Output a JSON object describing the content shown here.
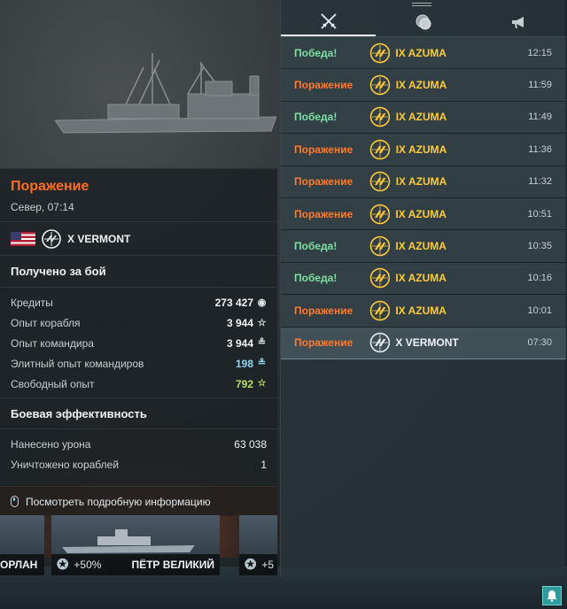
{
  "result": {
    "title": "Поражение",
    "subtitle": "Север, 07:14",
    "ship": "X VERMONT",
    "flag": "us-flag"
  },
  "earned": {
    "title": "Получено за бой",
    "rows": [
      {
        "label": "Кредиты",
        "value": "273 427",
        "icon": "credits-icon",
        "style": "white"
      },
      {
        "label": "Опыт корабля",
        "value": "3 944",
        "icon": "ship-xp-star-icon",
        "style": "white"
      },
      {
        "label": "Опыт командира",
        "value": "3 944",
        "icon": "commander-xp-icon",
        "style": "white"
      },
      {
        "label": "Элитный опыт командиров",
        "value": "198",
        "icon": "elite-commander-xp-icon",
        "style": "blue"
      },
      {
        "label": "Свободный опыт",
        "value": "792",
        "icon": "free-xp-star-icon",
        "style": "green"
      }
    ]
  },
  "efficiency": {
    "title": "Боевая эффективность",
    "rows": [
      {
        "label": "Нанесено урона",
        "value": "63 038"
      },
      {
        "label": "Уничтожено кораблей",
        "value": "1"
      }
    ]
  },
  "detail_button": "Посмотреть подробную информацию",
  "carousel": [
    {
      "name": "ОРЛАН",
      "boost": ""
    },
    {
      "name": "ПЁТР ВЕЛИКИЙ",
      "boost": "+50%"
    },
    {
      "name": "",
      "boost": "+5"
    }
  ],
  "notifications": {
    "tabs": [
      {
        "name": "battles",
        "icon": "crossed-swords-icon"
      },
      {
        "name": "coins",
        "icon": "coins-icon"
      },
      {
        "name": "news",
        "icon": "megaphone-icon"
      }
    ],
    "rows": [
      {
        "outcome": "Победа!",
        "kind": "win",
        "ship": "IX AZUMA",
        "time": "12:15"
      },
      {
        "outcome": "Поражение",
        "kind": "loss",
        "ship": "IX AZUMA",
        "time": "11:59"
      },
      {
        "outcome": "Победа!",
        "kind": "win",
        "ship": "IX AZUMA",
        "time": "11:49"
      },
      {
        "outcome": "Поражение",
        "kind": "loss",
        "ship": "IX AZUMA",
        "time": "11:36"
      },
      {
        "outcome": "Поражение",
        "kind": "loss",
        "ship": "IX AZUMA",
        "time": "11:32"
      },
      {
        "outcome": "Поражение",
        "kind": "loss",
        "ship": "IX AZUMA",
        "time": "10:51"
      },
      {
        "outcome": "Победа!",
        "kind": "win",
        "ship": "IX AZUMA",
        "time": "10:35"
      },
      {
        "outcome": "Победа!",
        "kind": "win",
        "ship": "IX AZUMA",
        "time": "10:16"
      },
      {
        "outcome": "Поражение",
        "kind": "loss",
        "ship": "IX AZUMA",
        "time": "10:01"
      },
      {
        "outcome": "Поражение",
        "kind": "loss",
        "ship": "X VERMONT",
        "time": "07:30"
      }
    ]
  },
  "colors": {
    "loss": "#ff7a2e",
    "win": "#7be0a2",
    "gold": "#ffcb3a",
    "elite_xp": "#8fd7ef",
    "free_xp": "#b8e06a",
    "bell": "#2f9b9b"
  }
}
